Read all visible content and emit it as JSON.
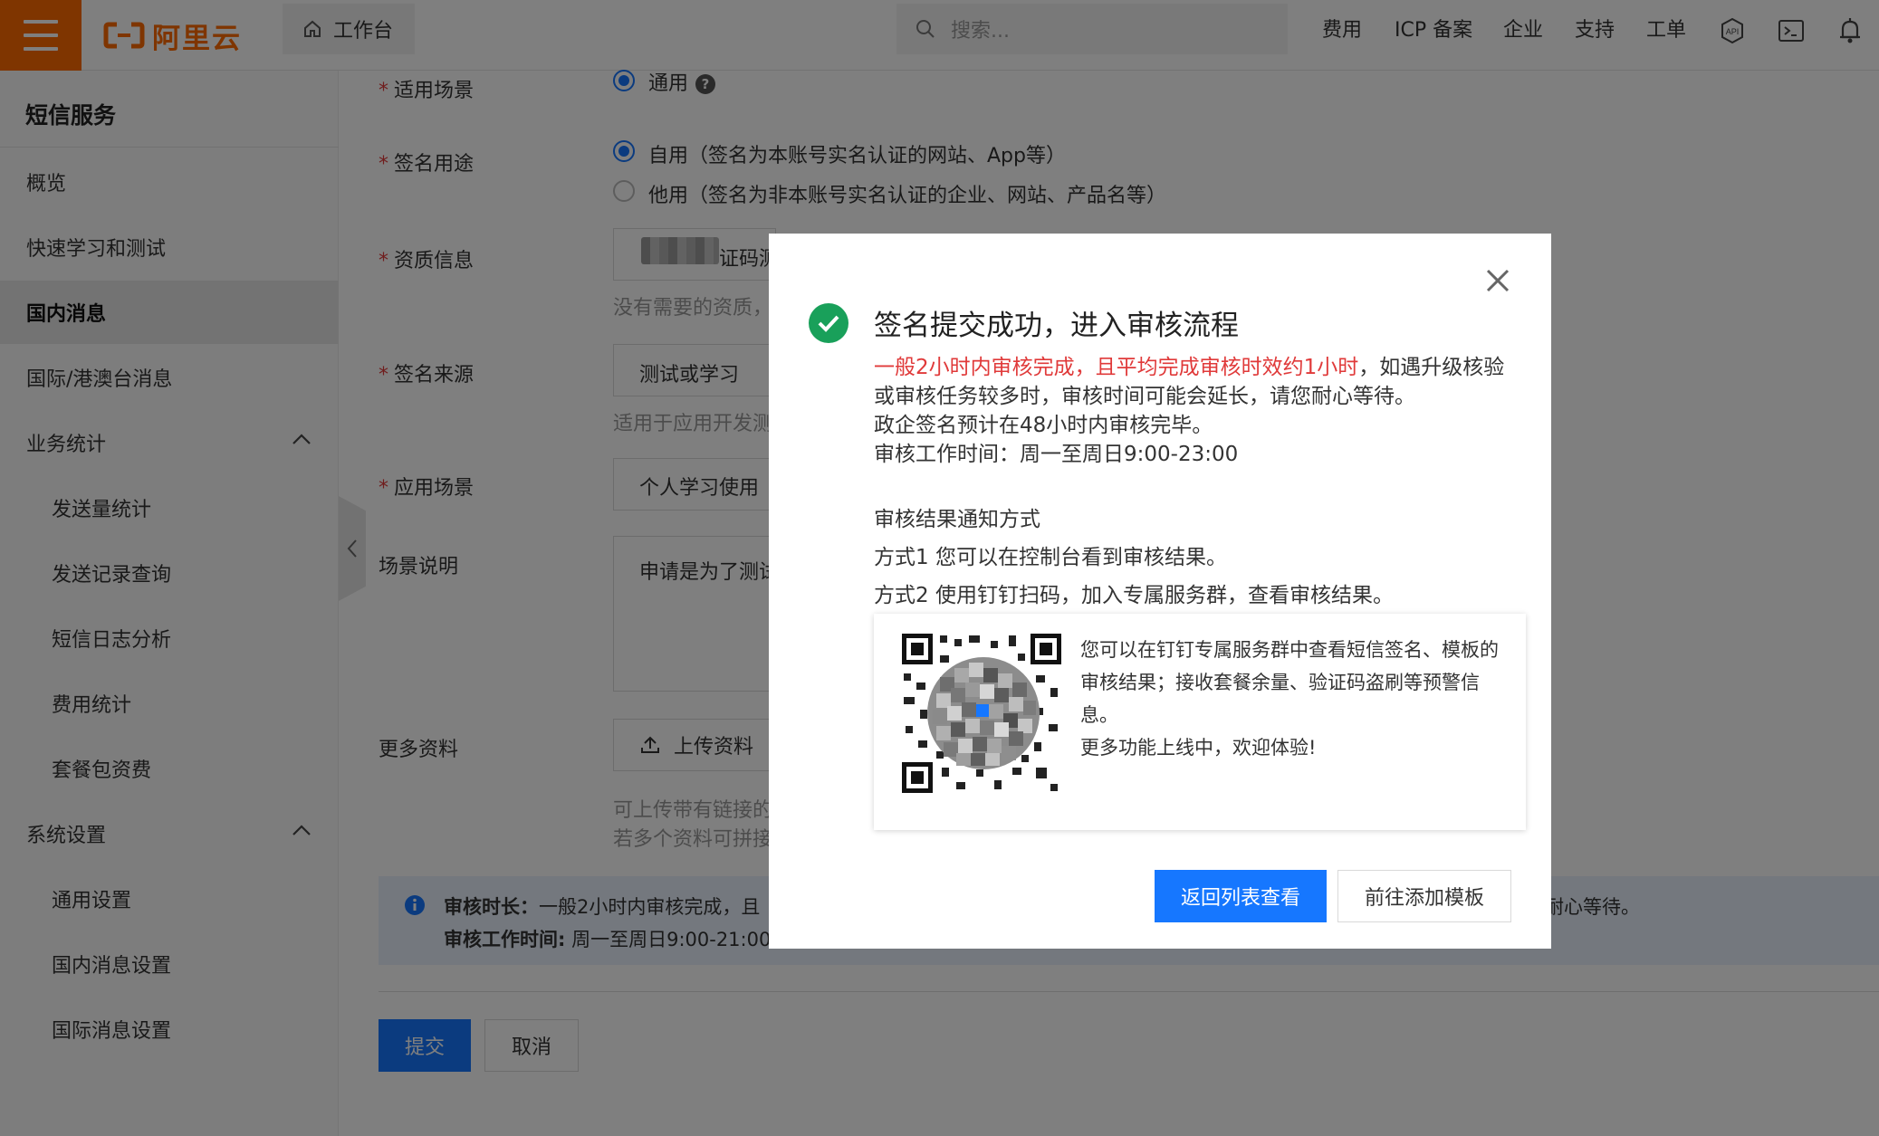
{
  "topbar": {
    "brand": "阿里云",
    "workbench_label": "工作台",
    "search_placeholder": "搜索...",
    "nav": [
      "费用",
      "ICP 备案",
      "企业",
      "支持",
      "工单"
    ],
    "accent_color": "#ff6a00",
    "icons": [
      "menu-icon",
      "home-icon",
      "search-icon",
      "api-icon",
      "terminal-icon",
      "bell-icon"
    ]
  },
  "sidebar": {
    "title": "短信服务",
    "items": [
      {
        "label": "概览"
      },
      {
        "label": "快速学习和测试"
      },
      {
        "label": "国内消息",
        "active": true
      },
      {
        "label": "国际/港澳台消息"
      },
      {
        "label": "业务统计",
        "expanded": true
      },
      {
        "label": "发送量统计"
      },
      {
        "label": "发送记录查询"
      },
      {
        "label": "短信日志分析"
      },
      {
        "label": "费用统计"
      },
      {
        "label": "套餐包资费"
      },
      {
        "label": "系统设置",
        "expanded": true
      },
      {
        "label": "通用设置"
      },
      {
        "label": "国内消息设置"
      },
      {
        "label": "国际消息设置"
      }
    ]
  },
  "form": {
    "scenario": {
      "label": "适用场景",
      "option": "通用"
    },
    "purpose": {
      "label": "签名用途",
      "options": [
        "自用（签名为本账号实名认证的网站、App等）",
        "他用（签名为非本账号实名认证的企业、网站、产品名等）"
      ],
      "selected": 0
    },
    "qualification": {
      "label": "资质信息",
      "value_tail": "证码测",
      "hint": "没有需要的资质，"
    },
    "source": {
      "label": "签名来源",
      "value": "测试或学习",
      "hint": "适用于应用开发测"
    },
    "app_scenario": {
      "label": "应用场景",
      "value": "个人学习使用"
    },
    "description": {
      "label": "场景说明",
      "value": "申请是为了测试"
    },
    "more": {
      "label": "更多资料",
      "upload_label": "上传资料",
      "hint1": "可上传带有链接的",
      "hint2": "若多个资料可拼接"
    },
    "notice": {
      "line1_bold": "审核时长：",
      "line1_text": "一般2小时内审核完成，且",
      "line1_tail": "耐心等待。",
      "line2_bold": "审核工作时间:",
      "line2_text": " 周一至周日9:00-21:00"
    },
    "submit_label": "提交",
    "cancel_label": "取消",
    "required_mark": "*"
  },
  "modal": {
    "title": "签名提交成功，进入审核流程",
    "red_text": "一般2小时内审核完成，且平均完成审核时效约1小时",
    "body_rest": "，如遇升级核验或审核任务较多时，审核时间可能会延长，请您耐心等待。",
    "line_gov": "政企签名预计在48小时内审核完毕。",
    "line_hours": "审核工作时间：周一至周日9:00-23:00",
    "notify_title": "审核结果通知方式",
    "method1": "方式1 您可以在控制台看到审核结果。",
    "method2": "方式2 使用钉钉扫码，加入专属服务群，查看审核结果。",
    "qr_text1": "您可以在钉钉专属服务群中查看短信签名、模板的审核结果；接收套餐余量、验证码盗刷等预警信息。",
    "qr_text2": "更多功能上线中，欢迎体验!",
    "primary_label": "返回列表查看",
    "secondary_label": "前往添加模板",
    "primary_color": "#1677ff",
    "success_color": "#19a05a",
    "warning_color": "#e03a3a"
  }
}
